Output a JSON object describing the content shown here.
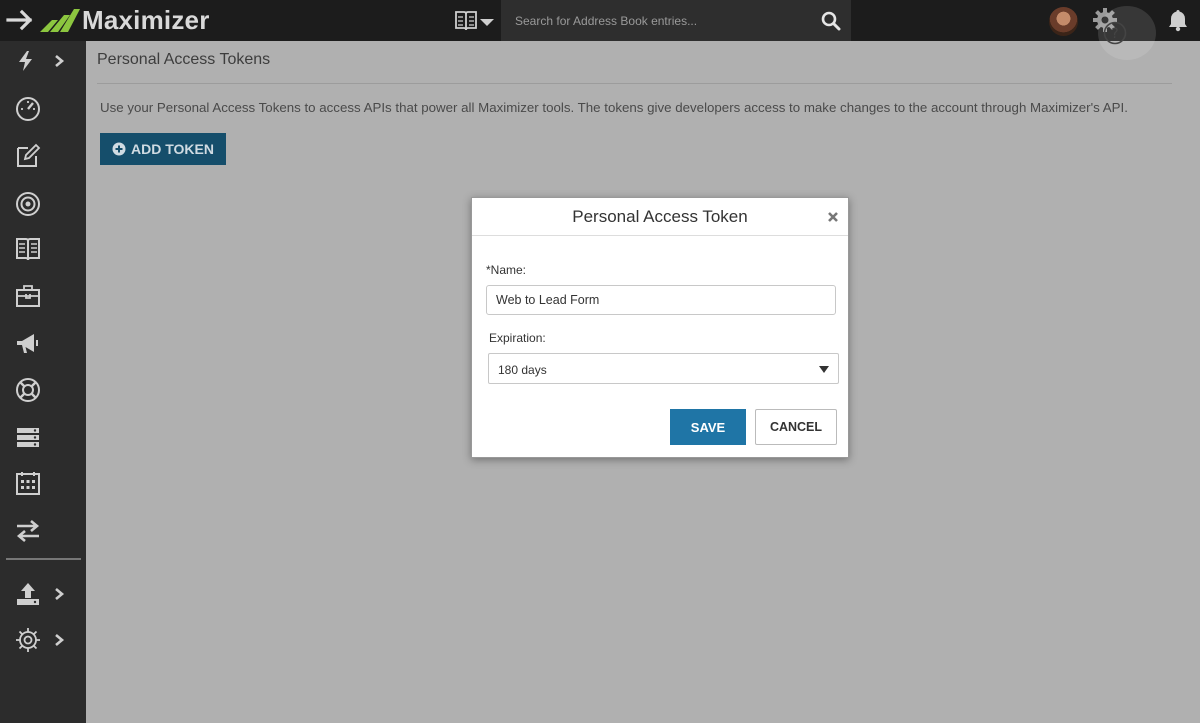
{
  "app": {
    "brand_name": "Maximizer",
    "accent_color": "#1f75a6",
    "brand_green": "#8cc63f"
  },
  "topbar": {
    "search_placeholder": "Search for Address Book entries...",
    "icons": [
      "exit-arrow-icon",
      "address-book-icon",
      "chevron-down-icon",
      "search-icon",
      "avatar",
      "gear-icon",
      "help-icon",
      "bell-icon"
    ]
  },
  "sidebar": {
    "items": [
      {
        "icon": "lightning-icon",
        "has_flyout": true
      },
      {
        "icon": "dashboard-gauge-icon"
      },
      {
        "icon": "edit-note-icon"
      },
      {
        "icon": "target-icon"
      },
      {
        "icon": "address-book-icon"
      },
      {
        "icon": "briefcase-icon"
      },
      {
        "icon": "megaphone-icon"
      },
      {
        "icon": "lifebuoy-icon"
      },
      {
        "icon": "list-icon"
      },
      {
        "icon": "calendar-icon"
      },
      {
        "icon": "transfer-arrows-icon"
      },
      {
        "icon": "upload-icon",
        "has_flyout": true
      },
      {
        "icon": "settings-gear-icon",
        "has_flyout": true
      }
    ]
  },
  "page": {
    "title": "Personal Access Tokens",
    "description": "Use your Personal Access Tokens to access APIs that power all Maximizer tools. The tokens give developers access to make changes to the account through Maximizer's API.",
    "add_token_label": "ADD TOKEN"
  },
  "modal": {
    "title": "Personal Access Token",
    "name_label": "*Name:",
    "name_value": "Web to Lead Form",
    "expiration_label": "Expiration:",
    "expiration_value": "180 days",
    "save_label": "SAVE",
    "cancel_label": "CANCEL"
  }
}
